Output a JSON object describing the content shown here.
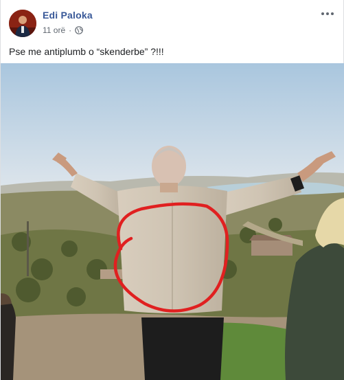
{
  "post": {
    "author": "Edi Paloka",
    "time": "11 orë",
    "separator": "·",
    "privacy_icon": "globe-icon",
    "menu_icon": "more-options-icon",
    "text": "Pse me antiplumb o “skenderbe” ?!!!"
  },
  "colors": {
    "author": "#385898",
    "meta": "#606770",
    "highlight": "#e02020"
  }
}
